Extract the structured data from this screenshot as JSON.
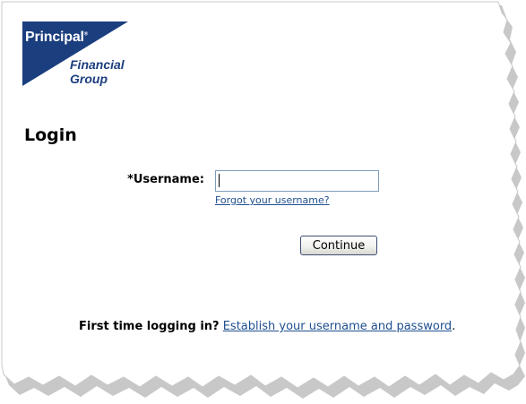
{
  "logo": {
    "brand_top": "Principal",
    "registered_mark": "®",
    "brand_line2": "Financial",
    "brand_line3": "Group",
    "triangle_color": "#1b3e7e",
    "text_color": "#1b3e7e"
  },
  "page": {
    "title": "Login"
  },
  "form": {
    "username_label": "*Username:",
    "username_value": "",
    "forgot_username_link": "Forgot your username?",
    "continue_button": "Continue"
  },
  "footer": {
    "question": "First time logging in?",
    "establish_link": "Establish your username and password",
    "trailing_period": "."
  },
  "colors": {
    "link": "#1f4f8f",
    "input_border": "#7f9db9",
    "button_border": "#3c4e73"
  }
}
